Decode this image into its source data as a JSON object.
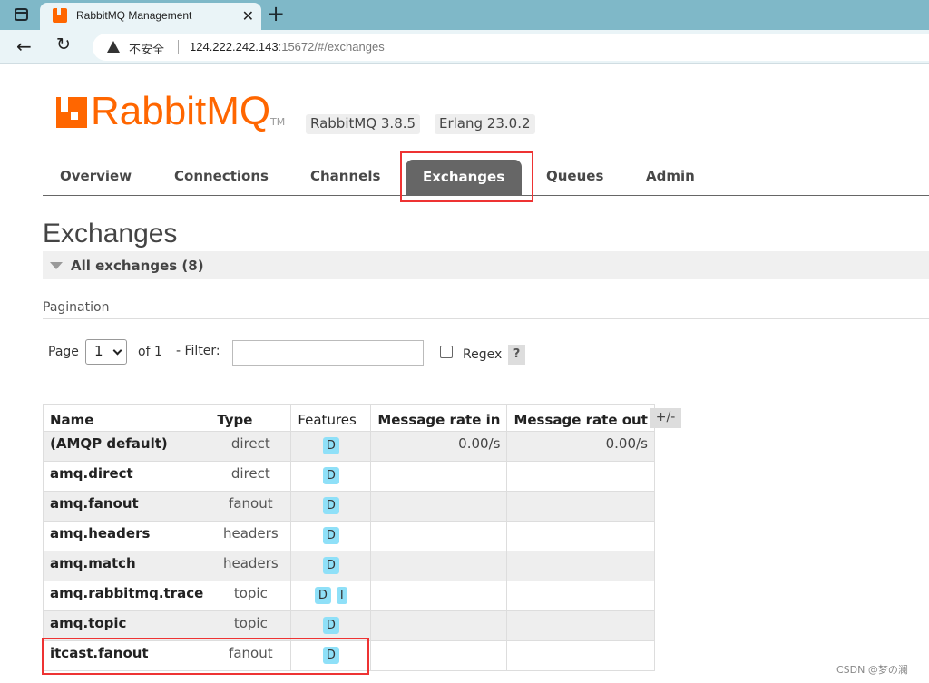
{
  "browser": {
    "tab_title": "RabbitMQ Management",
    "security_label": "不安全",
    "url_host": "124.222.242.143",
    "url_rest": ":15672/#/exchanges"
  },
  "header": {
    "logo_text": "RabbitMQ",
    "logo_tm": "TM",
    "version_badge": "RabbitMQ 3.8.5",
    "erlang_badge": "Erlang 23.0.2"
  },
  "nav": {
    "tabs": [
      "Overview",
      "Connections",
      "Channels",
      "Exchanges",
      "Queues",
      "Admin"
    ],
    "active": "Exchanges"
  },
  "page": {
    "title": "Exchanges",
    "section_title": "All exchanges (8)"
  },
  "pagination": {
    "label": "Pagination",
    "page_label": "Page",
    "page_value": "1",
    "of_label": "of 1",
    "filter_label": "- Filter:",
    "filter_value": "",
    "regex_label": "Regex",
    "help_label": "?"
  },
  "table": {
    "headers": [
      "Name",
      "Type",
      "Features",
      "Message rate in",
      "Message rate out"
    ],
    "toggle_label": "+/-",
    "rows": [
      {
        "name": "(AMQP default)",
        "type": "direct",
        "features": [
          "D"
        ],
        "rate_in": "0.00/s",
        "rate_out": "0.00/s"
      },
      {
        "name": "amq.direct",
        "type": "direct",
        "features": [
          "D"
        ],
        "rate_in": "",
        "rate_out": ""
      },
      {
        "name": "amq.fanout",
        "type": "fanout",
        "features": [
          "D"
        ],
        "rate_in": "",
        "rate_out": ""
      },
      {
        "name": "amq.headers",
        "type": "headers",
        "features": [
          "D"
        ],
        "rate_in": "",
        "rate_out": ""
      },
      {
        "name": "amq.match",
        "type": "headers",
        "features": [
          "D"
        ],
        "rate_in": "",
        "rate_out": ""
      },
      {
        "name": "amq.rabbitmq.trace",
        "type": "topic",
        "features": [
          "D",
          "I"
        ],
        "rate_in": "",
        "rate_out": ""
      },
      {
        "name": "amq.topic",
        "type": "topic",
        "features": [
          "D"
        ],
        "rate_in": "",
        "rate_out": ""
      },
      {
        "name": "itcast.fanout",
        "type": "fanout",
        "features": [
          "D"
        ],
        "rate_in": "",
        "rate_out": ""
      }
    ]
  },
  "watermark": "CSDN @梦の澜",
  "colors": {
    "brand": "#ff6600",
    "active_tab": "#666666",
    "highlight": "#e33333",
    "feature_tag": "#8fe0f8"
  }
}
